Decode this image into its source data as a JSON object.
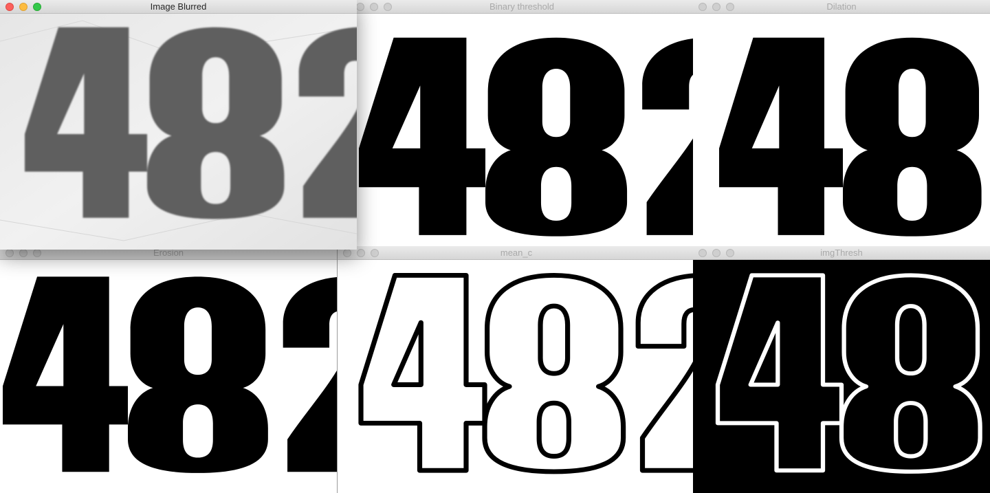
{
  "windows": [
    {
      "id": "binary",
      "title": "Binary threshold",
      "active": false
    },
    {
      "id": "dilation",
      "title": "Dilation",
      "active": false
    },
    {
      "id": "erosion",
      "title": "Erosion",
      "active": false
    },
    {
      "id": "meanc",
      "title": "mean_c",
      "active": false
    },
    {
      "id": "imgthresh",
      "title": "imgThresh",
      "active": false
    },
    {
      "id": "blurred",
      "title": "Image Blurred",
      "active": true
    }
  ],
  "image_text": "482",
  "window_controls": [
    "close-icon",
    "minimize-icon",
    "zoom-icon"
  ],
  "colors": {
    "close": "#fc605c",
    "minimize": "#fdbc40",
    "zoom": "#34c84a",
    "blurred_ink": "#5f5f5f",
    "blurred_paper": "#ececec"
  }
}
